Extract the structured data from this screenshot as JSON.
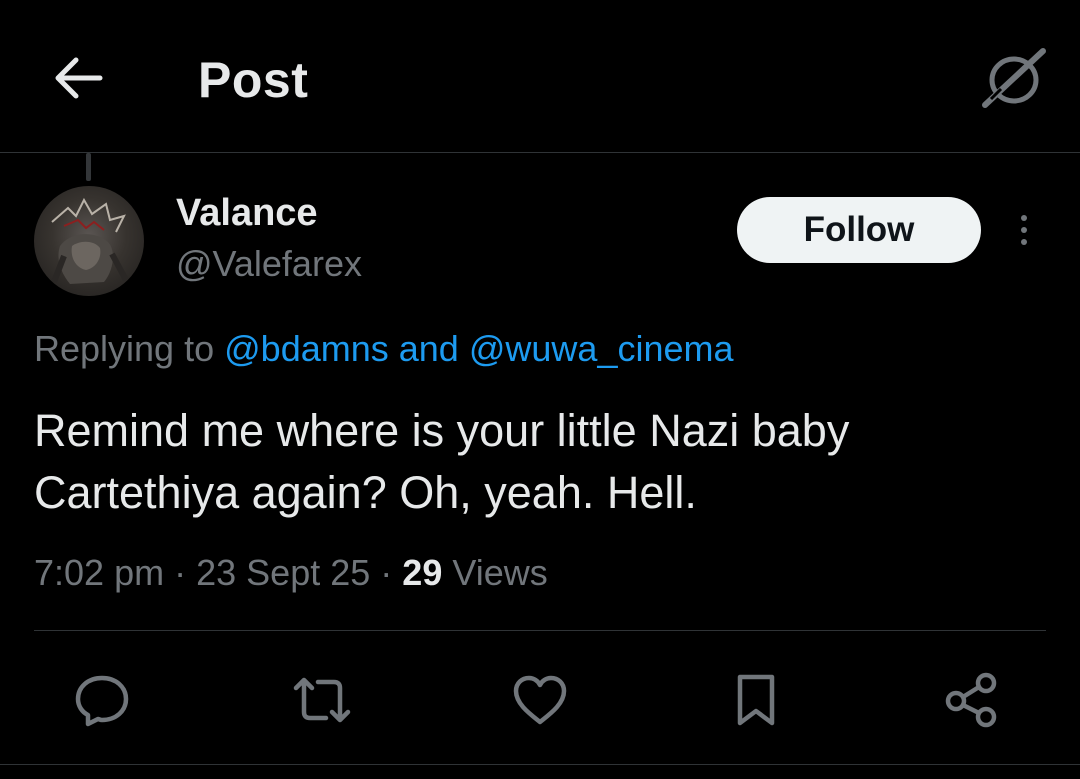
{
  "header": {
    "title": "Post",
    "back_icon": "arrow-left-icon",
    "grok_icon": "grok-icon"
  },
  "tweet": {
    "author": {
      "name": "Valance",
      "handle": "@Valefarex"
    },
    "follow_label": "Follow",
    "more_icon": "more-dots-icon",
    "reply": {
      "prefix": "Replying to",
      "mention_1": "@bdamns",
      "connector": "and",
      "mention_2": "@wuwa_cinema"
    },
    "text_line_1": "Remind me where is your little Nazi baby",
    "text_line_2": "Cartethiya again? Oh, yeah. Hell.",
    "meta": {
      "time": "7:02 pm",
      "date": "23 Sept 25",
      "views_count": "29",
      "views_label": "Views",
      "separator": "·"
    },
    "actions": [
      "reply-icon",
      "retweet-icon",
      "like-icon",
      "bookmark-icon",
      "share-icon"
    ]
  },
  "colors": {
    "background": "#000000",
    "text_primary": "#e7e9ea",
    "text_secondary": "#71767b",
    "link": "#1d9bf0",
    "follow_bg": "#eff3f4",
    "divider": "#2f3336"
  }
}
